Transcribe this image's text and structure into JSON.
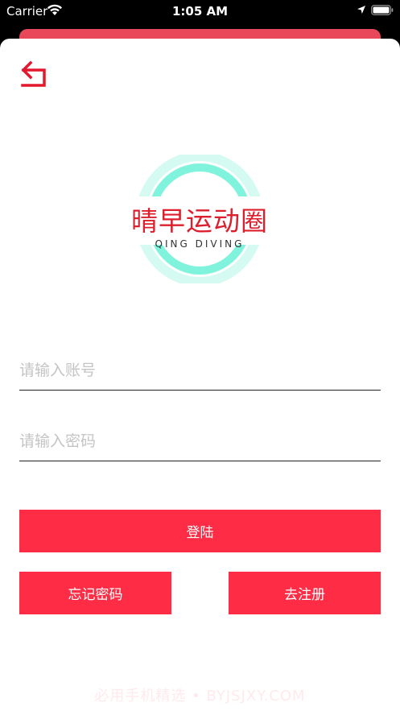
{
  "status_bar": {
    "carrier": "Carrier",
    "time": "1:05 AM"
  },
  "logo": {
    "title": "晴早运动圈",
    "subtitle": "QING DIVING"
  },
  "form": {
    "account_placeholder": "请输入账号",
    "password_placeholder": "请输入密码"
  },
  "buttons": {
    "login": "登陆",
    "forgot_password": "忘记密码",
    "register": "去注册"
  },
  "watermark": "必用手机精选 • BYJSJXY.COM",
  "colors": {
    "accent": "#fe2c44",
    "logo_red": "#dc1f2d",
    "logo_ring": "#6ff0d6"
  }
}
